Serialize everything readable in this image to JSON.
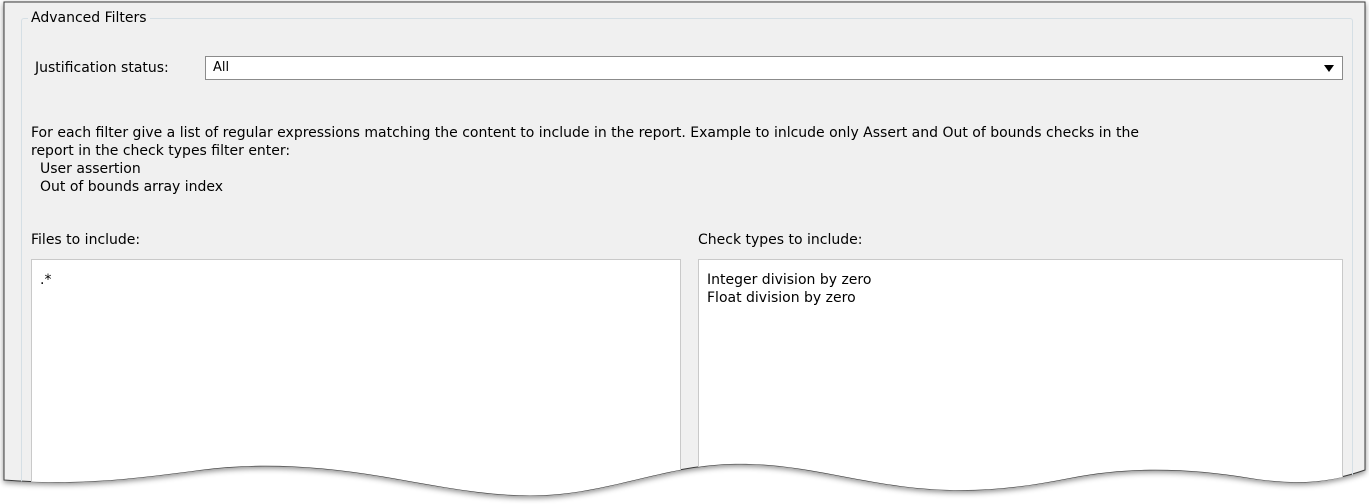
{
  "group": {
    "legend": "Advanced Filters"
  },
  "justification": {
    "label": "Justification status:",
    "selected": "All"
  },
  "description": {
    "line1": "For each filter give a list of regular expressions matching the content to include in the report. Example to inlcude only Assert and Out of bounds checks in the",
    "line2": "report in the check types filter enter:",
    "example1": "User assertion",
    "example2": "Out of bounds array index"
  },
  "files": {
    "label": "Files to include:",
    "lines": [
      ".*"
    ]
  },
  "checks": {
    "label": "Check types to include:",
    "lines": [
      "Integer division by zero",
      "Float division by zero"
    ]
  },
  "colors": {
    "panel": "#f0f0f0",
    "group_border": "#d5dfe5",
    "field_border": "#8b8b8b"
  },
  "icons": {
    "dropdown": "chevron-down-icon"
  }
}
